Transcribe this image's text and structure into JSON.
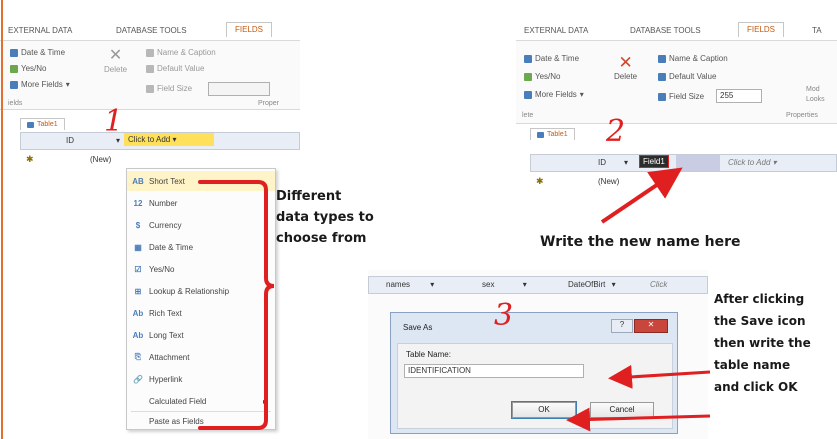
{
  "panel1": {
    "tabs": [
      "EXTERNAL DATA",
      "DATABASE TOOLS",
      "FIELDS"
    ],
    "ribbon": {
      "date_time": "Date & Time",
      "yes_no": "Yes/No",
      "more_fields": "More Fields",
      "delete": "Delete",
      "name_caption": "Name & Caption",
      "default_value": "Default Value",
      "field_size": "Field Size",
      "group_left": "ields",
      "group_right": "Proper"
    },
    "table_tab": "Table1",
    "columns": {
      "id": "ID",
      "click_to_add": "Click to Add"
    },
    "new_row": "(New)",
    "number_label": "1",
    "menu_items": [
      {
        "icon": "AB",
        "label": "Short Text"
      },
      {
        "icon": "12",
        "label": "Number"
      },
      {
        "icon": "$",
        "label": "Currency"
      },
      {
        "icon": "▦",
        "label": "Date & Time"
      },
      {
        "icon": "☑",
        "label": "Yes/No"
      },
      {
        "icon": "⊞",
        "label": "Lookup & Relationship"
      },
      {
        "icon": "Ab",
        "label": "Rich Text"
      },
      {
        "icon": "Ab",
        "label": "Long Text"
      },
      {
        "icon": "⎘",
        "label": "Attachment"
      },
      {
        "icon": "🔗",
        "label": "Hyperlink"
      },
      {
        "icon": "",
        "label": "Calculated Field"
      },
      {
        "icon": "",
        "label": "Paste as Fields"
      }
    ],
    "annotation": [
      "Different",
      "data types to",
      "choose from"
    ]
  },
  "panel2": {
    "tabs": [
      "EXTERNAL DATA",
      "DATABASE TOOLS",
      "FIELDS",
      "TA"
    ],
    "ribbon": {
      "date_time": "Date & Time",
      "yes_no": "Yes/No",
      "more_fields": "More Fields",
      "delete": "Delete",
      "name_caption": "Name & Caption",
      "default_value": "Default Value",
      "field_size": "Field Size",
      "field_size_value": "255",
      "modify": "Mod",
      "lookups": "Looks",
      "group_left": "lete",
      "group_right": "Properties"
    },
    "table_tab": "Table1",
    "columns": {
      "id": "ID",
      "field1": "Field1",
      "click_to_add": "Click to Add"
    },
    "new_row": "(New)",
    "number_label": "2",
    "annotation": "Write the new name here"
  },
  "panel3": {
    "columns": [
      "names",
      "sex",
      "DateOfBirt",
      "Click"
    ],
    "number_label": "3",
    "dialog": {
      "title": "Save As",
      "field_label": "Table Name:",
      "value": "IDENTIFICATION",
      "ok": "OK",
      "cancel": "Cancel",
      "help": "?",
      "close": "✕"
    },
    "annotation": [
      "After clicking",
      "the Save icon",
      "then write the",
      "table name",
      "and click OK"
    ]
  },
  "colors": {
    "arrow_red": "#e02020",
    "accent_orange": "#c55a11",
    "highlight_yellow": "#ffe05a"
  }
}
